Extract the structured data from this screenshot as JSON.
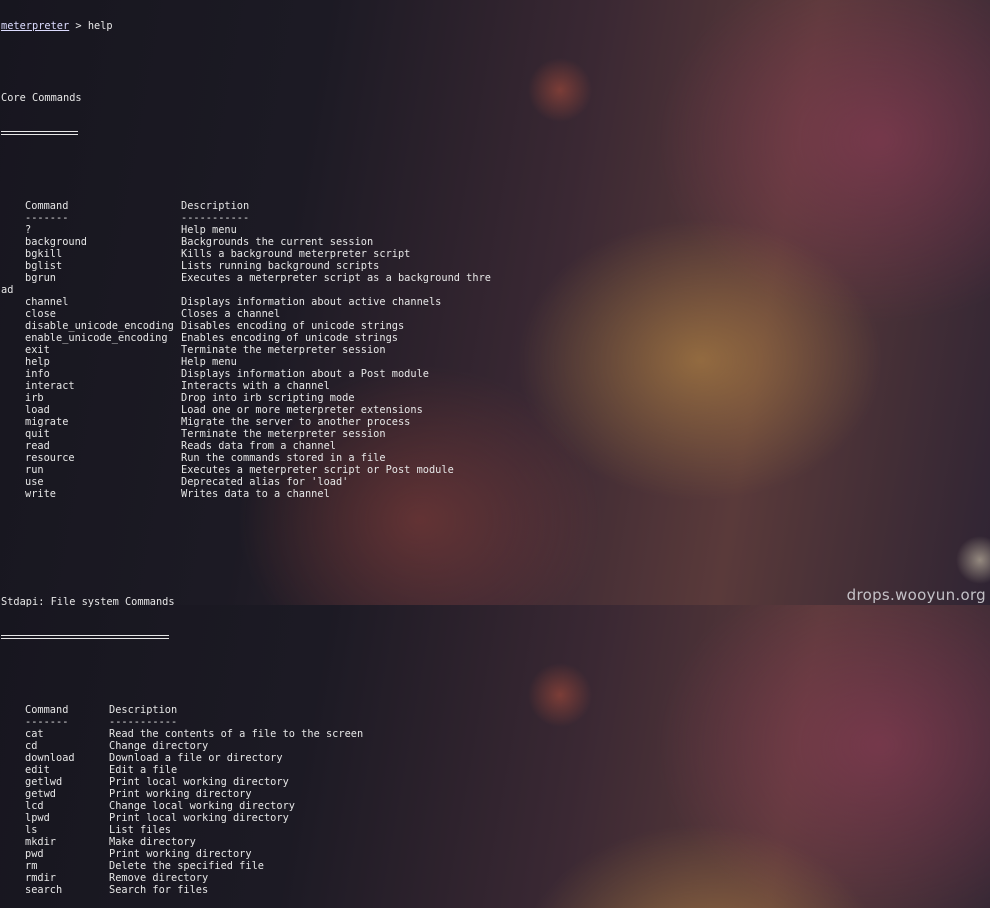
{
  "prompt": {
    "host": "meterpreter",
    "sep": " > ",
    "cmd": "help"
  },
  "core": {
    "title": "Core Commands",
    "header": {
      "command": "Command",
      "description": "Description"
    },
    "dash": {
      "command": "-------",
      "description": "-----------"
    },
    "rows": [
      {
        "c": "?",
        "d": "Help menu"
      },
      {
        "c": "background",
        "d": "Backgrounds the current session"
      },
      {
        "c": "bgkill",
        "d": "Kills a background meterpreter script"
      },
      {
        "c": "bglist",
        "d": "Lists running background scripts"
      },
      {
        "c": "bgrun",
        "d": "Executes a meterpreter script as a background thre"
      },
      {
        "c": "channel",
        "d": "Displays information about active channels"
      },
      {
        "c": "close",
        "d": "Closes a channel"
      },
      {
        "c": "disable_unicode_encoding",
        "d": "Disables encoding of unicode strings"
      },
      {
        "c": "enable_unicode_encoding",
        "d": "Enables encoding of unicode strings"
      },
      {
        "c": "exit",
        "d": "Terminate the meterpreter session"
      },
      {
        "c": "help",
        "d": "Help menu"
      },
      {
        "c": "info",
        "d": "Displays information about a Post module"
      },
      {
        "c": "interact",
        "d": "Interacts with a channel"
      },
      {
        "c": "irb",
        "d": "Drop into irb scripting mode"
      },
      {
        "c": "load",
        "d": "Load one or more meterpreter extensions"
      },
      {
        "c": "migrate",
        "d": "Migrate the server to another process"
      },
      {
        "c": "quit",
        "d": "Terminate the meterpreter session"
      },
      {
        "c": "read",
        "d": "Reads data from a channel"
      },
      {
        "c": "resource",
        "d": "Run the commands stored in a file"
      },
      {
        "c": "run",
        "d": "Executes a meterpreter script or Post module"
      },
      {
        "c": "use",
        "d": "Deprecated alias for 'load'"
      },
      {
        "c": "write",
        "d": "Writes data to a channel"
      }
    ],
    "wrap": "ad"
  },
  "stdapi": {
    "title": "Stdapi: File system Commands",
    "header": {
      "command": "Command",
      "description": "Description"
    },
    "dash": {
      "command": "-------",
      "description": "-----------"
    },
    "rows": [
      {
        "c": "cat",
        "d": "Read the contents of a file to the screen"
      },
      {
        "c": "cd",
        "d": "Change directory"
      },
      {
        "c": "download",
        "d": "Download a file or directory"
      },
      {
        "c": "edit",
        "d": "Edit a file"
      },
      {
        "c": "getlwd",
        "d": "Print local working directory"
      },
      {
        "c": "getwd",
        "d": "Print working directory"
      },
      {
        "c": "lcd",
        "d": "Change local working directory"
      },
      {
        "c": "lpwd",
        "d": "Print local working directory"
      },
      {
        "c": "ls",
        "d": "List files"
      },
      {
        "c": "mkdir",
        "d": "Make directory"
      },
      {
        "c": "pwd",
        "d": "Print working directory"
      },
      {
        "c": "rm",
        "d": "Delete the specified file"
      },
      {
        "c": "rmdir",
        "d": "Remove directory"
      },
      {
        "c": "search",
        "d": "Search for files"
      }
    ]
  },
  "watermark": "drops.wooyun.org"
}
